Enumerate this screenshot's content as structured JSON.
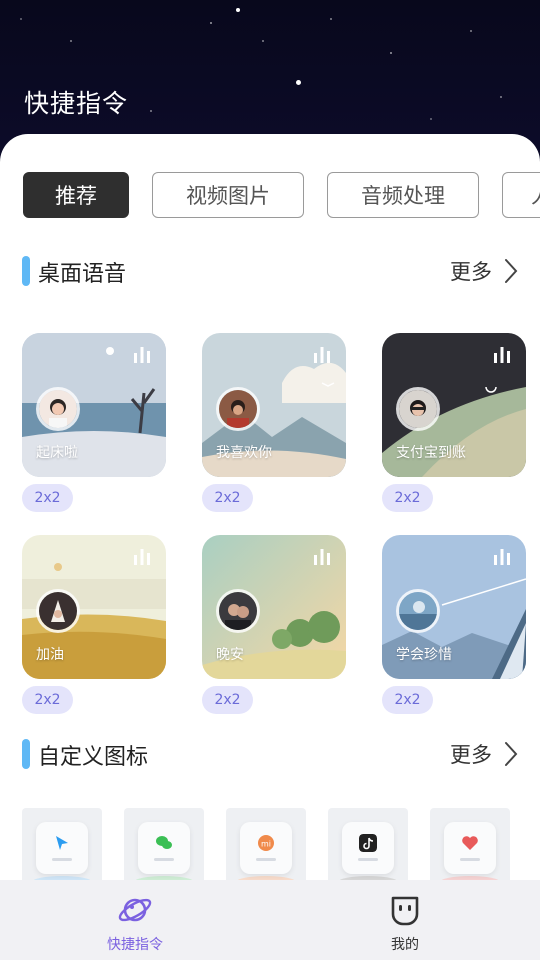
{
  "header": {
    "title": "快捷指令"
  },
  "tabs": [
    {
      "label": "推荐",
      "active": true
    },
    {
      "label": "视频图片",
      "active": false
    },
    {
      "label": "音频处理",
      "active": false
    },
    {
      "label": "人",
      "active": false
    }
  ],
  "voice_section": {
    "title": "桌面语音",
    "more_label": "更多"
  },
  "voice_cards": [
    {
      "label": "起床啦",
      "size": "2x2"
    },
    {
      "label": "我喜欢你",
      "size": "2x2"
    },
    {
      "label": "支付宝到账",
      "size": "2x2"
    },
    {
      "label": "加油",
      "size": "2x2"
    },
    {
      "label": "晚安",
      "size": "2x2"
    },
    {
      "label": "学会珍惜",
      "size": "2x2"
    }
  ],
  "icon_section": {
    "title": "自定义图标",
    "more_label": "更多"
  },
  "icon_tiles": [
    {
      "icon": "navigation-arrow-icon",
      "color": "#2b9cf0"
    },
    {
      "icon": "wechat-icon",
      "color": "#3bbf55"
    },
    {
      "icon": "mi-icon",
      "color": "#f08a4b"
    },
    {
      "icon": "tiktok-icon",
      "color": "#222222"
    },
    {
      "icon": "heart-icon",
      "color": "#e85a5a"
    }
  ],
  "bottom_nav": [
    {
      "label": "快捷指令",
      "icon": "planet-icon",
      "active": true,
      "color": "#7b61e0"
    },
    {
      "label": "我的",
      "icon": "face-icon",
      "active": false,
      "color": "#333333"
    }
  ],
  "colors": {
    "accent": "#7b61e0",
    "section_bar": "#5fb8f5",
    "badge_bg": "#e4e4fb",
    "badge_text": "#6b6bd8"
  }
}
